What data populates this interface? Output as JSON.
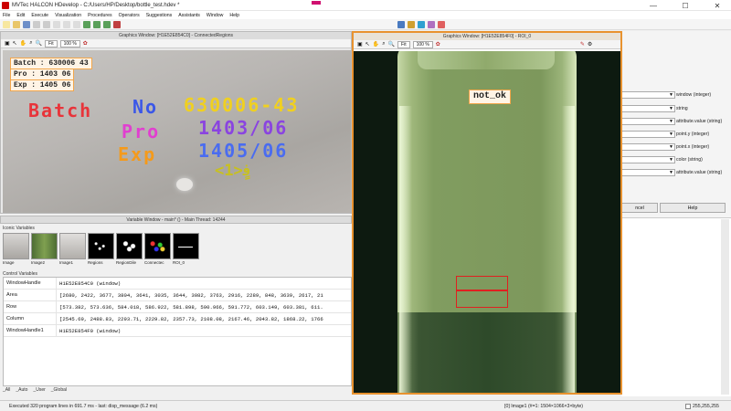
{
  "app": {
    "title": "MVTec HALCON HDevelop - C:/Users/HP/Desktop/bottle_test.hdev *",
    "window_controls": [
      "—",
      "☐",
      "✕"
    ]
  },
  "menu": [
    "File",
    "Edit",
    "Execute",
    "Visualization",
    "Procedures",
    "Operators",
    "Suggestions",
    "Assistants",
    "Window",
    "Help"
  ],
  "gw1": {
    "title": "Graphics Window: [H1E52E854C0] - ConnectedRegions",
    "fit_label": "Fit",
    "zoom_label": "100 %",
    "overlays": {
      "batch": "Batch : 630006 43",
      "pro": "Pro : 1403 06",
      "exp": "Exp : 1405 06"
    },
    "regions": {
      "line1a": "Batch",
      "line1b": "No",
      "line1c": "630006-43",
      "line2a": "Pro",
      "line2b": "1403/06",
      "line3a": "Exp",
      "line3b": "1405/06",
      "line4": "<1>ف‍‍‍‍ٍ"
    }
  },
  "var_window": {
    "title": "Variable Window - main* () - Main Thread: 14244",
    "iconic_label": "Iconic Variables",
    "thumbs": [
      "Image",
      "Image2",
      "Image1",
      "Regions",
      "RegionDile",
      "Connectec",
      "ROI_0"
    ],
    "control_label": "Control Variables",
    "rows": [
      {
        "k": "WindowHandle",
        "v": "H1E52E854C0 (window)"
      },
      {
        "k": "Area",
        "v": "[2680, 2422, 3677, 3804, 3641, 3035, 3644, 3082, 3763, 2916, 2289, 848, 3639, 2617, 21"
      },
      {
        "k": "Row",
        "v": "[573.382, 573.636, 584.018, 586.922, 581.898, 590.966, 591.772, 603.149, 603.381, 611."
      },
      {
        "k": "Column",
        "v": "[2545.69, 2488.83, 2293.71, 2229.82, 2357.73, 2108.08, 2167.46, 2043.82, 1868.22, 1766"
      },
      {
        "k": "WindowHandle1",
        "v": "H1E52E854F0 (window)"
      }
    ],
    "tabs": [
      "_All",
      "_Auto",
      "_User",
      "_Global"
    ]
  },
  "gw2": {
    "title": "Graphics Window: [H1E52E854F0] - ROI_0",
    "fit_label": "Fit",
    "zoom_label": "100 %",
    "result_label": "not_ok"
  },
  "right_panel": {
    "types": [
      "window (integer)",
      "string",
      "attribute.value (string)",
      "point.y (integer)",
      "point.x (integer)",
      "color (string)",
      "attribute.value (string)"
    ],
    "cancel_label": "ncel",
    "help_label": "Help"
  },
  "status": {
    "message": "Executed 320 program lines in 691.7 ms - last: disp_message (6.2 ms)",
    "image_info": "[0] Image1 (#=1: 1504×1066×3×byte)",
    "pixel_value": "255,255,255"
  }
}
